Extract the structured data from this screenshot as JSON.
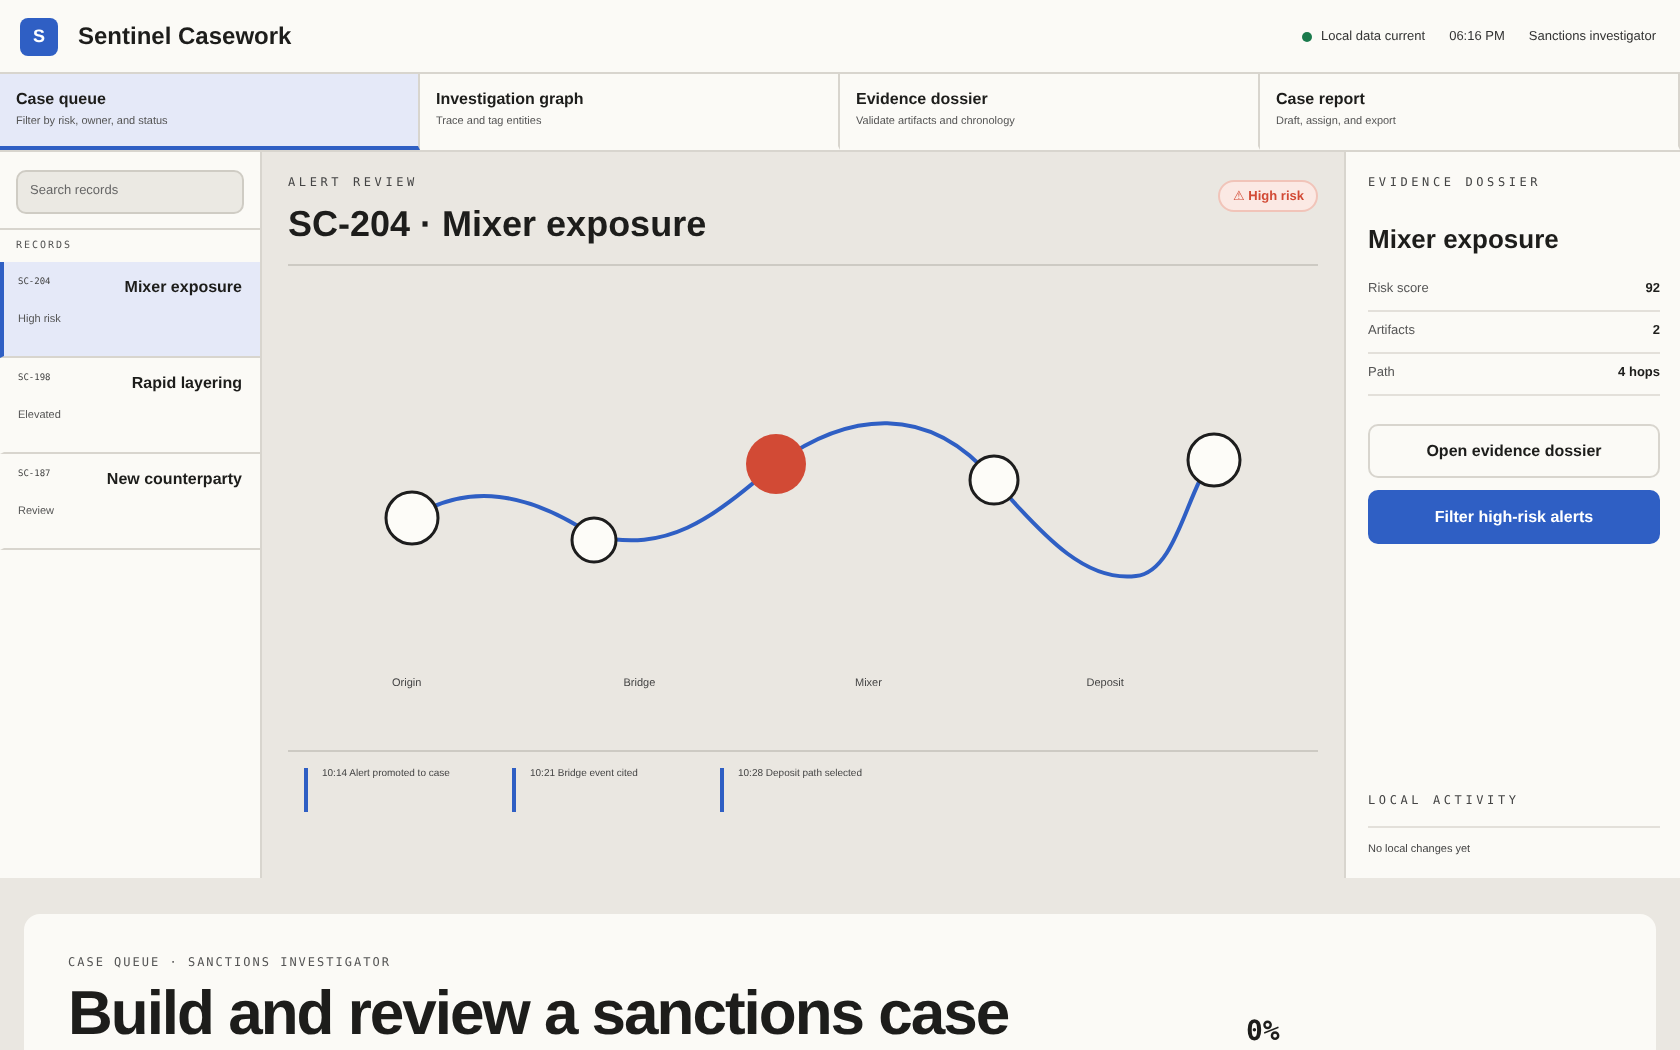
{
  "app": {
    "logo": "S",
    "title": "Sentinel Casework",
    "sync_status": "Local data current",
    "sync_ok": true,
    "time": "06:16 PM",
    "role": "Sanctions investigator"
  },
  "tabs": [
    {
      "label": "Case queue",
      "subtitle": "Filter by risk, owner, and status",
      "selected": true
    },
    {
      "label": "Investigation graph",
      "subtitle": "Trace and tag entities",
      "selected": false
    },
    {
      "label": "Evidence dossier",
      "subtitle": "Validate artifacts and chronology",
      "selected": false
    },
    {
      "label": "Case report",
      "subtitle": "Draft, assign, and export",
      "selected": false
    }
  ],
  "sidebar": {
    "search": {
      "placeholder": "Search records"
    },
    "heading": "RECORDS",
    "records": [
      {
        "id": "SC-204",
        "title": "Mixer exposure",
        "status": "High risk",
        "selected": true
      },
      {
        "id": "SC-198",
        "title": "Rapid layering",
        "status": "Elevated",
        "selected": false
      },
      {
        "id": "SC-187",
        "title": "New counterparty",
        "status": "Review",
        "selected": false
      }
    ]
  },
  "review": {
    "eyebrow": "ALERT REVIEW",
    "title": "SC-204 · Mixer exposure",
    "badge": {
      "icon": "⚠",
      "label": "High risk"
    },
    "graph": {
      "nodes": [
        {
          "flagged": false
        },
        {
          "flagged": false
        },
        {
          "flagged": true
        },
        {
          "flagged": false
        },
        {
          "flagged": false
        }
      ],
      "labels": [
        "Origin",
        "Bridge",
        "Mixer",
        "Deposit"
      ]
    },
    "timeline": [
      "10:14 Alert promoted to case",
      "10:21 Bridge event cited",
      "10:28 Deposit path selected"
    ]
  },
  "dossier": {
    "eyebrow": "EVIDENCE DOSSIER",
    "title": "Mixer exposure",
    "facts": [
      {
        "label": "Risk score",
        "value": "92"
      },
      {
        "label": "Artifacts",
        "value": "2"
      },
      {
        "label": "Path",
        "value": "4 hops"
      }
    ],
    "buttons": [
      {
        "label": "Open evidence dossier",
        "kind": "secondary"
      },
      {
        "label": "Filter high-risk alerts",
        "kind": "primary"
      }
    ],
    "activity_heading": "LOCAL ACTIVITY",
    "activity_empty": "No local changes yet"
  },
  "banner": {
    "eyebrow": "CASE QUEUE · SANCTIONS INVESTIGATOR",
    "title": "Build and review a sanctions case",
    "progress": "0%"
  }
}
